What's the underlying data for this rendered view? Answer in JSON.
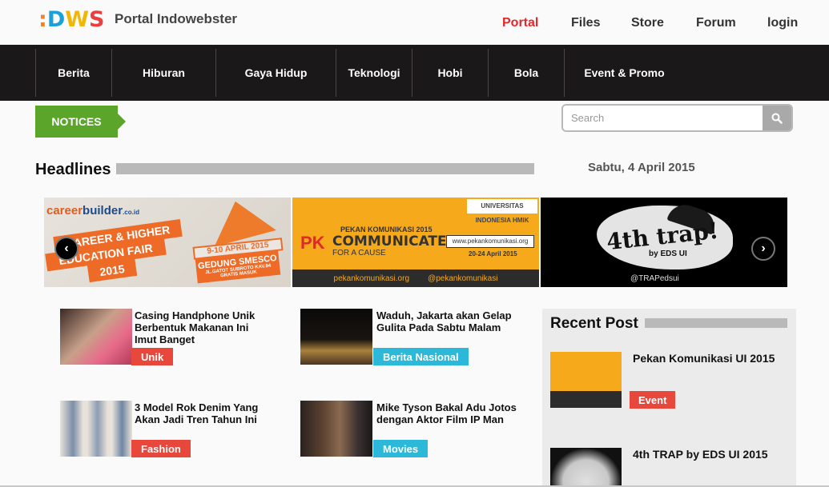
{
  "header": {
    "logo_dot": ":",
    "logo_d": "D",
    "logo_w": "W",
    "logo_s": "S",
    "site_title": "Portal Indowebster",
    "nav": [
      "Portal",
      "Files",
      "Store",
      "Forum",
      "login"
    ],
    "active_nav": "Portal"
  },
  "categories": [
    "Berita",
    "Hiburan",
    "Gaya Hidup",
    "Teknologi",
    "Hobi",
    "Bola",
    "Event & Promo"
  ],
  "notices_label": "NOTICES",
  "search": {
    "placeholder": "Search"
  },
  "headlines": {
    "title": "Headlines",
    "date": "Sabtu, 4 April 2015"
  },
  "slides": {
    "slide1": {
      "brand_a": "career",
      "brand_b": "builder",
      "brand_c": ".co.id",
      "line1": "CAREER & HIGHER",
      "line2": "EDUCATION FAIR",
      "line3": "2015",
      "dates": "9-10 APRIL 2015",
      "venue": "GEDUNG SMESCO",
      "venue_sub": "JL.GATOT SUBROTO KAV.94",
      "free": "GRATIS MASUK"
    },
    "slide2": {
      "small": "PEKAN KOMUNIKASI 2015",
      "logo": "PK",
      "main": "COMMUNICATE",
      "sub": "FOR A CAUSE",
      "url": "www.pekankomunikasi.org",
      "dates": "20-24 April 2015",
      "top": "UNIVERSITAS INDONESIA  HMIK",
      "foot_a": "pekankomunikasi.org",
      "foot_b": "@pekankomunikasi"
    },
    "slide3": {
      "title": "4th trap!",
      "sub": "by EDS UI",
      "foot": "@TRAPedsui"
    },
    "prev_glyph": "‹",
    "next_glyph": "›"
  },
  "articles": [
    {
      "title": "Casing Handphone Unik Berbentuk Makanan Ini Imut Banget",
      "tag": "Unik"
    },
    {
      "title": "Waduh, Jakarta akan Gelap Gulita Pada Sabtu Malam",
      "tag": "Berita Nasional"
    },
    {
      "title": "3 Model Rok Denim Yang Akan Jadi Tren Tahun Ini",
      "tag": "Fashion"
    },
    {
      "title": "Mike Tyson Bakal Adu Jotos dengan Aktor Film IP Man",
      "tag": "Movies"
    }
  ],
  "recent": {
    "title": "Recent Post",
    "posts": [
      {
        "title": "Pekan Komunikasi UI 2015",
        "tag": "Event"
      },
      {
        "title": "4th TRAP by EDS UI 2015"
      }
    ]
  },
  "colors": {
    "accent_red": "#e0282d",
    "notice_green": "#5aa52a",
    "tag_red": "#e8473c",
    "tag_cyan": "#2bb8d9",
    "nav_bg": "#1a1818"
  },
  "icons": {
    "search": "search-icon",
    "prev": "chevron-left-icon",
    "next": "chevron-right-icon"
  }
}
